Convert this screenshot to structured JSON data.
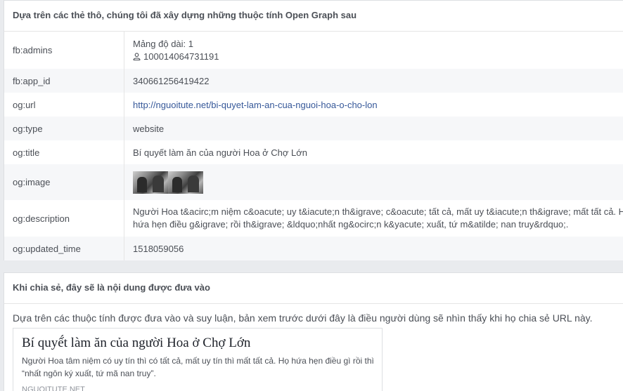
{
  "section1": {
    "title": "Dựa trên các thẻ thô, chúng tôi đã xây dựng những thuộc tính Open Graph sau",
    "rows": [
      {
        "key": "fb:admins",
        "line1": "Mảng độ dài: 1",
        "line2": "100014064731191",
        "icon": "user-icon"
      },
      {
        "key": "fb:app_id",
        "value": "340661256419422"
      },
      {
        "key": "og:url",
        "value": "http://nguoitute.net/bi-quyet-lam-an-cua-nguoi-hoa-o-cho-lon"
      },
      {
        "key": "og:type",
        "value": "website"
      },
      {
        "key": "og:title",
        "value": "Bí quyết làm ăn của người Hoa ở Chợ Lớn"
      },
      {
        "key": "og:image",
        "value": ""
      },
      {
        "key": "og:description",
        "line1": "Người Hoa t&acirc;m niệm c&oacute; uy t&iacute;n th&igrave; c&oacute; tất cả, mất uy t&iacute;n th&igrave; mất tất cả. Họ",
        "line2": "hứa hẹn điều g&igrave; rồi th&igrave; &ldquo;nhất ng&ocirc;n k&yacute; xuất, tứ m&atilde; nan truy&rdquo;."
      },
      {
        "key": "og:updated_time",
        "value": "1518059056"
      }
    ]
  },
  "section2": {
    "title": "Khi chia sẻ, đây sẽ là nội dung được đưa vào",
    "intro": "Dựa trên các thuộc tính được đưa vào và suy luận, bản xem trước dưới đây là điều người dùng sẽ nhìn thấy khi họ chia sẻ URL này.",
    "preview": {
      "title": "Bí quyế́t làm ăn của người Hoa ở Chợ Lớn",
      "desc_line1": "Người Hoa tâm niệm có uy tín thì có tất cả, mất uy tín thì mất tất cả. Họ hứa hẹn điều gì rồi thì",
      "desc_line2": "“nhất ngôn ký xuất, tứ mã nan truy”.",
      "domain": "NGUOITUTE.NET"
    }
  },
  "colors": {
    "background": "#e9ebee",
    "link": "#365899",
    "alt_row": "#f6f7f9"
  }
}
